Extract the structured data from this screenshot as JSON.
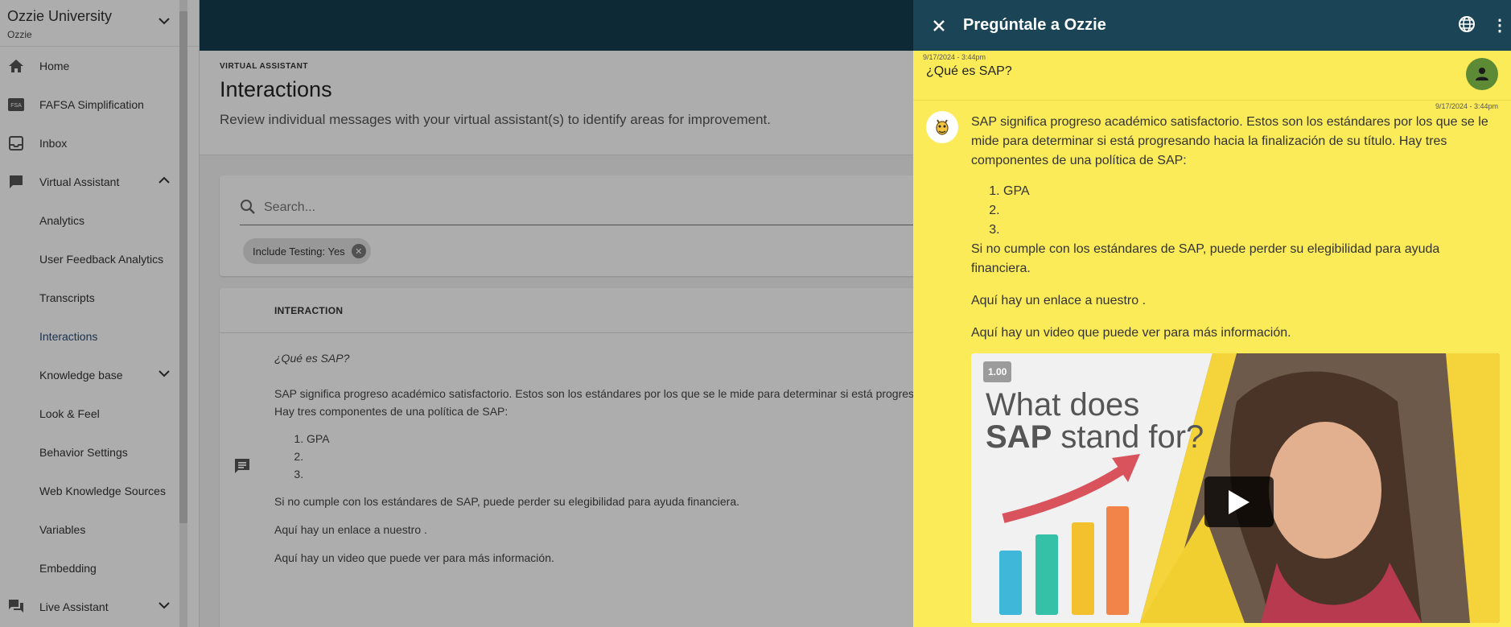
{
  "org": {
    "name": "Ozzie University",
    "sub": "Ozzie"
  },
  "nav": {
    "home": "Home",
    "fafsa": "FAFSA Simplification",
    "inbox": "Inbox",
    "virtual_assistant": "Virtual Assistant",
    "analytics": "Analytics",
    "user_feedback": "User Feedback Analytics",
    "transcripts": "Transcripts",
    "interactions": "Interactions",
    "knowledge_base": "Knowledge base",
    "look_feel": "Look & Feel",
    "behavior": "Behavior Settings",
    "web_sources": "Web Knowledge Sources",
    "variables": "Variables",
    "embedding": "Embedding",
    "live_assistant": "Live Assistant"
  },
  "page": {
    "eyebrow": "VIRTUAL ASSISTANT",
    "title": "Interactions",
    "description": "Review individual messages with your virtual assistant(s) to identify areas for improvement."
  },
  "search": {
    "placeholder": "Search...",
    "chip": "Include Testing: Yes"
  },
  "table": {
    "header": "INTERACTION",
    "row": {
      "question": "¿Qué es SAP?",
      "answer_line1": "SAP significa progreso académico satisfactorio. Estos son los estándares por los que se le mide para determinar si está progres",
      "answer_line2": "Hay tres componentes de una política de SAP:",
      "items": [
        "GPA",
        "",
        ""
      ],
      "p2": "Si no cumple con los estándares de SAP, puede perder su elegibilidad para ayuda financiera.",
      "p3": "Aquí hay un enlace a nuestro .",
      "p4": "Aquí hay un video que puede ver para más información."
    }
  },
  "chat": {
    "title": "Pregúntale a Ozzie",
    "user_time": "9/17/2024 - 3:44pm",
    "user_message": "¿Qué es SAP?",
    "bot_time": "9/17/2024 - 3:44pm",
    "bot_p1": "SAP significa progreso académico satisfactorio. Estos son los estándares por los que se le mide para determinar si está progresando hacia la finalización de su título. Hay tres componentes de una política de SAP:",
    "bot_items": [
      "GPA",
      "",
      ""
    ],
    "bot_p2": "Si no cumple con los estándares de SAP, puede perder su elegibilidad para ayuda financiera.",
    "bot_p3": "Aquí hay un enlace a nuestro .",
    "bot_p4": "Aquí hay un video que puede ver para más información.",
    "video": {
      "speed": "1.00",
      "line1": "What does",
      "line2_bold": "SAP",
      "line2_rest": " stand for?"
    }
  },
  "colors": {
    "topbar": "#143d4f",
    "chat_header": "#1b4557",
    "chat_background": "#fbeb59",
    "user_avatar": "#5d8a35"
  }
}
